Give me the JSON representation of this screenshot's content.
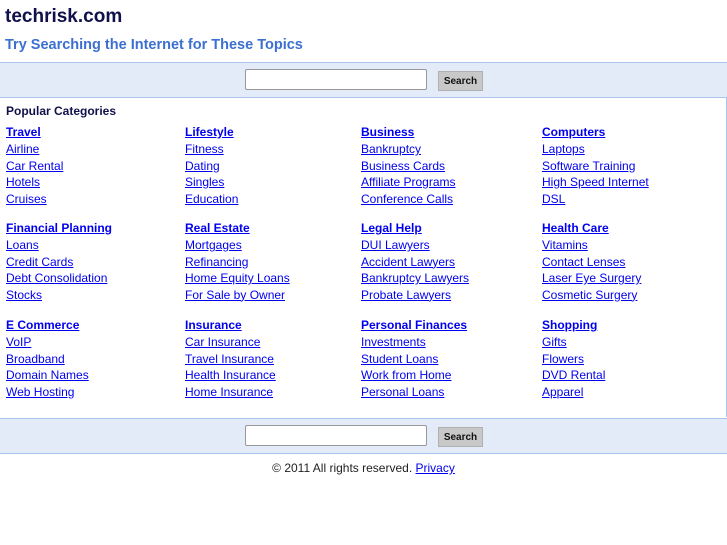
{
  "header": {
    "title": "techrisk.com",
    "subtitle": "Try Searching the Internet for These Topics"
  },
  "search": {
    "button_label": "Search",
    "value": ""
  },
  "popular_label": "Popular Categories",
  "categories": [
    {
      "title": "Travel",
      "items": [
        "Airline",
        "Car Rental",
        "Hotels",
        "Cruises"
      ]
    },
    {
      "title": "Lifestyle",
      "items": [
        "Fitness",
        "Dating",
        "Singles",
        "Education"
      ]
    },
    {
      "title": "Business",
      "items": [
        "Bankruptcy",
        "Business Cards",
        "Affiliate Programs",
        "Conference Calls"
      ]
    },
    {
      "title": "Computers",
      "items": [
        "Laptops",
        "Software Training",
        "High Speed Internet",
        "DSL"
      ]
    },
    {
      "title": "Financial Planning",
      "items": [
        "Loans",
        "Credit Cards",
        "Debt Consolidation",
        "Stocks"
      ]
    },
    {
      "title": "Real Estate",
      "items": [
        "Mortgages",
        "Refinancing",
        "Home Equity Loans",
        "For Sale by Owner"
      ]
    },
    {
      "title": "Legal Help",
      "items": [
        "DUI Lawyers",
        "Accident Lawyers",
        "Bankruptcy Lawyers",
        "Probate Lawyers"
      ]
    },
    {
      "title": "Health Care",
      "items": [
        "Vitamins",
        "Contact Lenses",
        "Laser Eye Surgery",
        "Cosmetic Surgery"
      ]
    },
    {
      "title": "E Commerce",
      "items": [
        "VoIP",
        "Broadband",
        "Domain Names",
        "Web Hosting"
      ]
    },
    {
      "title": "Insurance",
      "items": [
        "Car Insurance",
        "Travel Insurance",
        "Health Insurance",
        "Home Insurance"
      ]
    },
    {
      "title": "Personal Finances",
      "items": [
        "Investments",
        "Student Loans",
        "Work from Home",
        "Personal Loans"
      ]
    },
    {
      "title": "Shopping",
      "items": [
        "Gifts",
        "Flowers",
        "DVD Rental",
        "Apparel"
      ]
    }
  ],
  "footer": {
    "copyright": "© 2011 All rights reserved.",
    "privacy_label": "Privacy"
  }
}
